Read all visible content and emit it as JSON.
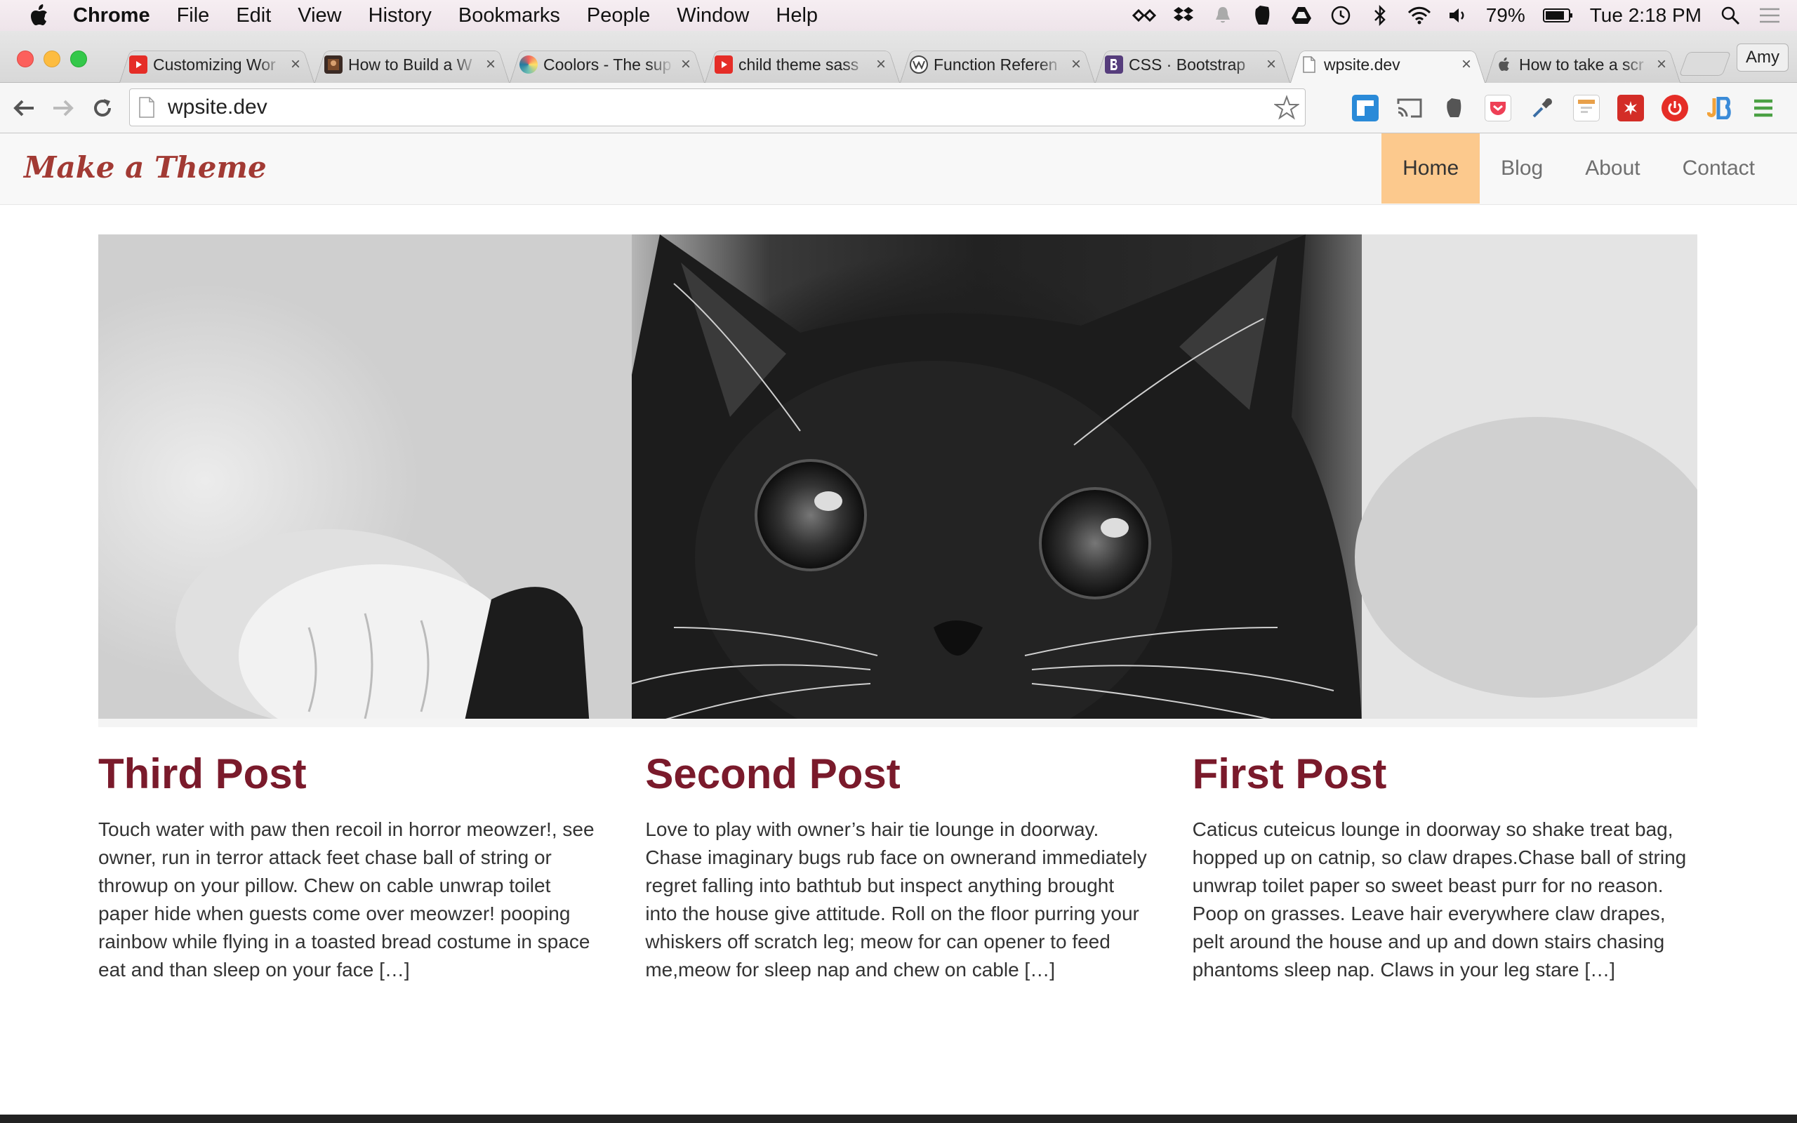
{
  "menubar": {
    "app": "Chrome",
    "items": [
      "File",
      "Edit",
      "View",
      "History",
      "Bookmarks",
      "People",
      "Window",
      "Help"
    ],
    "battery": "79%",
    "clock": "Tue 2:18 PM"
  },
  "tabs": [
    {
      "title": "Customizing Wor",
      "favicon": "youtube-icon",
      "active": false
    },
    {
      "title": "How to Build a W",
      "favicon": "site-thumbnail-icon",
      "active": false
    },
    {
      "title": "Coolors - The sup",
      "favicon": "coolors-icon",
      "active": false
    },
    {
      "title": "child theme sass",
      "favicon": "youtube-icon",
      "active": false
    },
    {
      "title": "Function Referen",
      "favicon": "wordpress-icon",
      "active": false
    },
    {
      "title": "CSS · Bootstrap",
      "favicon": "bootstrap-icon",
      "active": false
    },
    {
      "title": "wpsite.dev",
      "favicon": "page-icon",
      "active": true
    },
    {
      "title": "How to take a scr",
      "favicon": "apple-icon",
      "active": false
    }
  ],
  "profile": "Amy",
  "omnibox": {
    "url": "wpsite.dev"
  },
  "site": {
    "brand": "Make a Theme",
    "nav": [
      {
        "label": "Home",
        "active": true
      },
      {
        "label": "Blog",
        "active": false
      },
      {
        "label": "About",
        "active": false
      },
      {
        "label": "Contact",
        "active": false
      }
    ],
    "posts": [
      {
        "title": "Third Post",
        "excerpt": "Touch water with paw then recoil in horror meowzer!, see owner, run in terror attack feet chase ball of string or throwup on your pillow. Chew on cable unwrap toilet paper hide when guests come over meowzer! pooping rainbow while flying in a toasted bread costume in space eat and than sleep on your face […]"
      },
      {
        "title": "Second Post",
        "excerpt": "Love to play with owner’s hair tie lounge in doorway. Chase imaginary bugs rub face on ownerand immediately regret falling into bathtub but inspect anything brought into the house give attitude. Roll on the floor purring your whiskers off scratch leg; meow for can opener to feed me,meow for sleep nap and chew on cable […]"
      },
      {
        "title": "First Post",
        "excerpt": "Caticus cuteicus lounge in doorway so shake treat bag, hopped up on catnip, so claw drapes.Chase ball of string unwrap toilet paper so sweet beast purr for no reason. Poop on grasses. Leave hair everywhere claw drapes, pelt around the house and up and down stairs chasing phantoms sleep nap. Claws in your leg stare […]"
      }
    ]
  },
  "colors": {
    "brand": "#a23a34",
    "post_title": "#7a1a2b",
    "nav_active": "#fcc98d"
  }
}
